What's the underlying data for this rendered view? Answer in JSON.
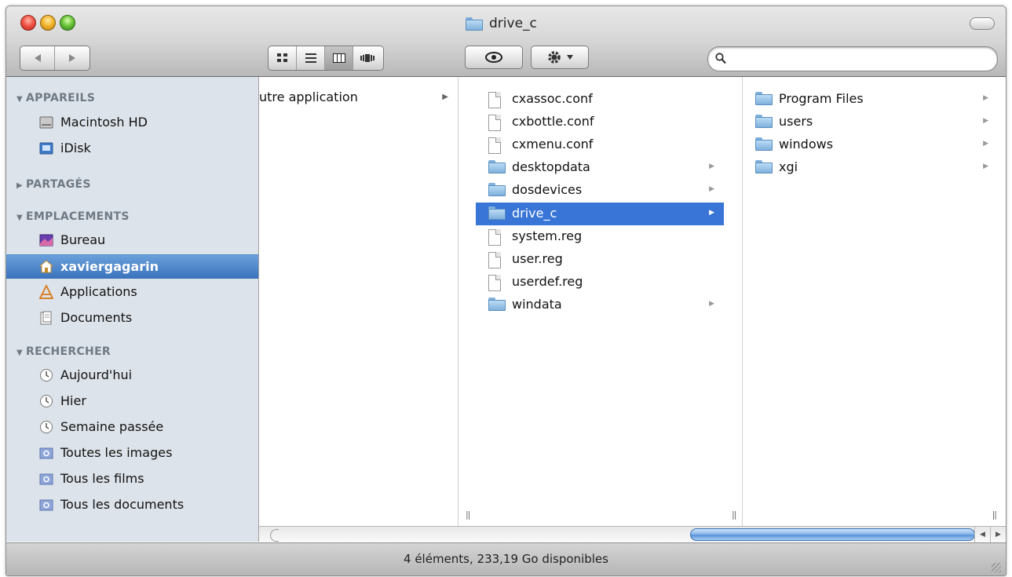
{
  "window": {
    "title": "drive_c"
  },
  "toolbar": {
    "back_glyph": "◀",
    "forward_glyph": "▶",
    "view_modes": [
      "icon-view",
      "list-view",
      "column-view",
      "coverflow-view"
    ],
    "active_view": "column-view",
    "quicklook_glyph": "👁",
    "action_glyph": "✲ ▾",
    "search_placeholder": ""
  },
  "sidebar": {
    "sections": [
      {
        "title": "APPAREILS",
        "expanded": true
      },
      {
        "title": "PARTAGÉS",
        "expanded": false
      },
      {
        "title": "EMPLACEMENTS",
        "expanded": true
      },
      {
        "title": "RECHERCHER",
        "expanded": true
      }
    ],
    "items": [
      {
        "label": "Macintosh HD",
        "icon": "hard-drive-icon"
      },
      {
        "label": "iDisk",
        "icon": "idisk-icon"
      },
      {
        "label": "Bureau",
        "icon": "desktop-icon"
      },
      {
        "label": "xaviergagarin",
        "icon": "home-icon",
        "selected": true
      },
      {
        "label": "Applications",
        "icon": "applications-icon"
      },
      {
        "label": "Documents",
        "icon": "documents-icon"
      },
      {
        "label": "Aujourd'hui",
        "icon": "clock-icon"
      },
      {
        "label": "Hier",
        "icon": "clock-icon"
      },
      {
        "label": "Semaine passée",
        "icon": "clock-icon"
      },
      {
        "label": "Toutes les images",
        "icon": "smart-folder-icon"
      },
      {
        "label": "Tous les films",
        "icon": "smart-folder-icon"
      },
      {
        "label": "Tous les documents",
        "icon": "smart-folder-icon"
      }
    ]
  },
  "columns": {
    "col1": [
      {
        "label": "utre application",
        "has_children": true
      }
    ],
    "col2": [
      {
        "label": "cxassoc.conf",
        "kind": "file"
      },
      {
        "label": "cxbottle.conf",
        "kind": "file"
      },
      {
        "label": "cxmenu.conf",
        "kind": "file"
      },
      {
        "label": "desktopdata",
        "kind": "folder"
      },
      {
        "label": "dosdevices",
        "kind": "folder"
      },
      {
        "label": "drive_c",
        "kind": "folder",
        "selected": true
      },
      {
        "label": "system.reg",
        "kind": "file"
      },
      {
        "label": "user.reg",
        "kind": "file"
      },
      {
        "label": "userdef.reg",
        "kind": "file"
      },
      {
        "label": "windata",
        "kind": "folder"
      }
    ],
    "col3": [
      {
        "label": "Program Files",
        "kind": "folder"
      },
      {
        "label": "users",
        "kind": "folder"
      },
      {
        "label": "windows",
        "kind": "folder"
      },
      {
        "label": "xgi",
        "kind": "folder"
      }
    ]
  },
  "status": {
    "text": "4 éléments, 233,19 Go disponibles"
  },
  "colors": {
    "selection": "#3875d7",
    "sidebar_bg": "#dde3ea",
    "sidebar_heading": "#6f7a85"
  }
}
